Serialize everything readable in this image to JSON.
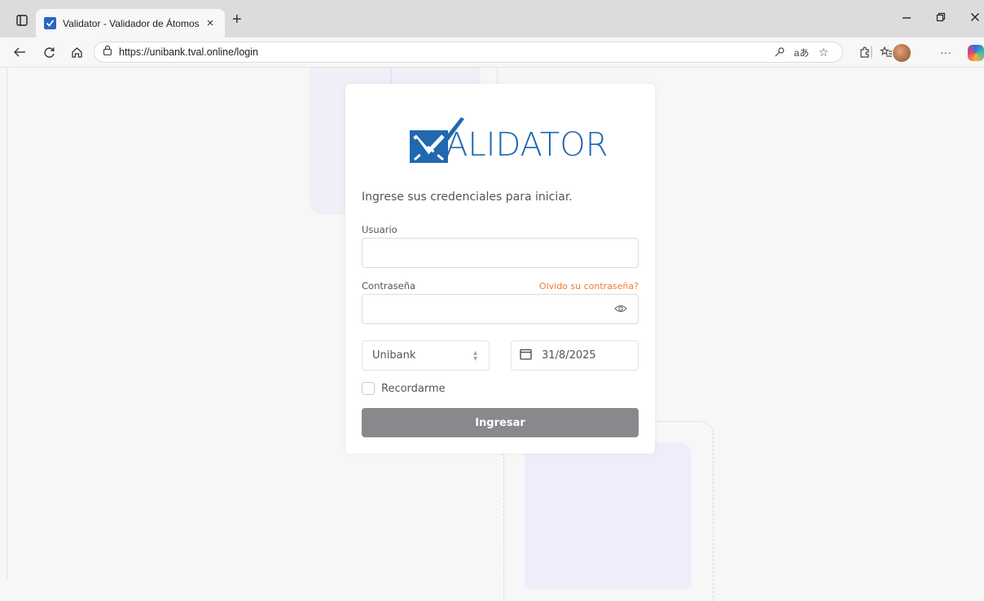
{
  "browser": {
    "tab_title": "Validator - Validador de Átomos",
    "tab_close": "×",
    "new_tab": "+",
    "url": "https://unibank.tval.online/login",
    "icons": [
      "sidebar-icon",
      "back-icon",
      "refresh-icon",
      "home-icon",
      "lock-icon",
      "key-icon",
      "read-aloud-icon",
      "favorite-star-icon",
      "extensions-icon",
      "favorites-icon",
      "profile-avatar",
      "more-icon",
      "copilot-icon",
      "minimize-icon",
      "restore-icon",
      "close-icon"
    ]
  },
  "login": {
    "logo_text": "ALIDATOR",
    "intro": "Ingrese sus credenciales para iniciar.",
    "username_label": "Usuario",
    "username_value": "",
    "password_label": "Contraseña",
    "password_value": "",
    "forgot_link": "Olvido su contraseña?",
    "company_selected": "Unibank",
    "date_value": "31/8/2025",
    "remember_label": "Recordarme",
    "submit_label": "Ingresar"
  },
  "colors": {
    "brand_blue": "#2068b0",
    "forgot_orange": "#f17c36",
    "button_gray": "#87898c"
  }
}
